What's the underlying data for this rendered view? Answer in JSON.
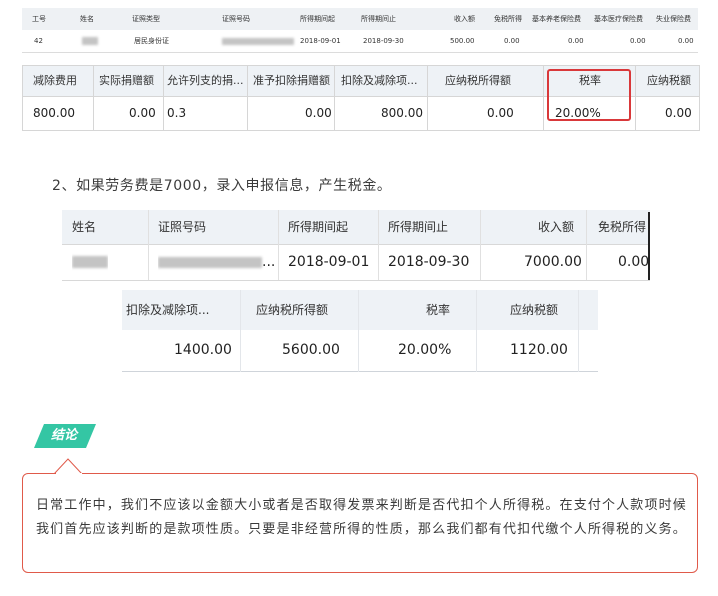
{
  "table1": {
    "headers": [
      "工号",
      "姓名",
      "证照类型",
      "证照号码",
      "所得期间起",
      "所得期间止",
      "收入额",
      "免税所得",
      "基本养老保险费",
      "基本医疗保险费",
      "失业保险费"
    ],
    "row": [
      "42",
      "",
      "居民身份证",
      "",
      "2018-09-01",
      "2018-09-30",
      "500.00",
      "0.00",
      "0.00",
      "0.00",
      "0.00"
    ]
  },
  "table2": {
    "headers": [
      "减除费用",
      "实际捐赠额",
      "允许列支的捐...",
      "准予扣除捐赠额",
      "扣除及减除项...",
      "应纳税所得额",
      "税率",
      "应纳税额"
    ],
    "row": [
      "800.00",
      "0.00",
      "0.3",
      "0.00",
      "800.00",
      "0.00",
      "20.00%",
      "0.00"
    ],
    "highlight_color": "#d9383a"
  },
  "paragraph": "2、如果劳务费是7000，录入申报信息，产生税金。",
  "table3": {
    "headers": [
      "姓名",
      "证照号码",
      "所得期间起",
      "所得期间止",
      "收入额",
      "免税所得"
    ],
    "row": [
      "",
      "...",
      "2018-09-01",
      "2018-09-30",
      "7000.00",
      "0.00"
    ]
  },
  "table4": {
    "headers": [
      "扣除及减除项...",
      "应纳税所得额",
      "税率",
      "应纳税额"
    ],
    "row": [
      "1400.00",
      "5600.00",
      "20.00%",
      "1120.00"
    ]
  },
  "conclusion": {
    "tag": "结论",
    "tag_color": "#34c6a4",
    "border_color": "#e05a4a",
    "text": "日常工作中，我们不应该以金额大小或者是否取得发票来判断是否代扣个人所得税。在支付个人款项时候我们首先应该判断的是款项性质。只要是非经营所得的性质，那么我们都有代扣代缴个人所得税的义务。"
  }
}
